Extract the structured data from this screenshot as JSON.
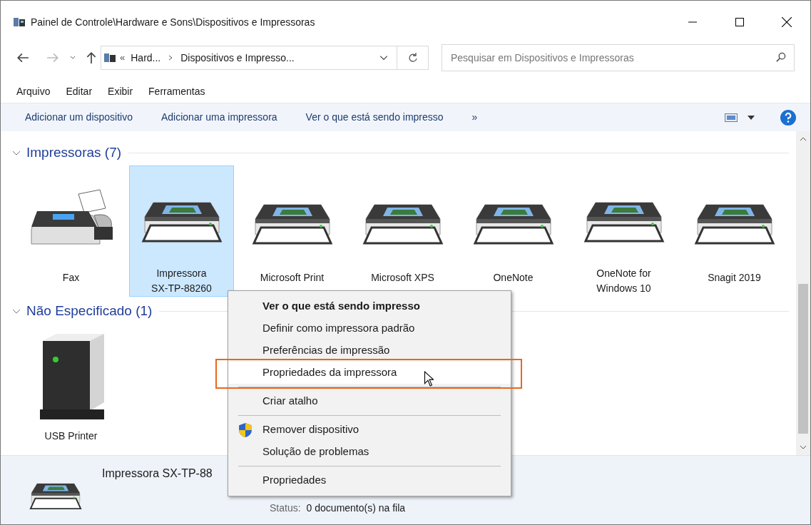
{
  "window": {
    "title": "Painel de Controle\\Hardware e Sons\\Dispositivos e Impressoras"
  },
  "address": {
    "overflow": "«",
    "crumbs": [
      "Hard...",
      "Dispositivos e Impresso..."
    ]
  },
  "search": {
    "placeholder": "Pesquisar em Dispositivos e Impressoras"
  },
  "menu_bar": [
    "Arquivo",
    "Editar",
    "Exibir",
    "Ferramentas"
  ],
  "command_bar": [
    "Adicionar um dispositivo",
    "Adicionar uma impressora",
    "Ver o que está sendo impresso",
    "»"
  ],
  "groups": [
    {
      "title": "Impressoras (7)",
      "expanded": true,
      "items": [
        {
          "kind": "fax",
          "lines": [
            "Fax"
          ],
          "selected": false
        },
        {
          "kind": "printer",
          "lines": [
            "Impressora",
            "SX-TP-88260"
          ],
          "selected": true
        },
        {
          "kind": "printer",
          "lines": [
            "Microsoft Print"
          ],
          "selected": false
        },
        {
          "kind": "printer",
          "lines": [
            "Microsoft XPS"
          ],
          "selected": false
        },
        {
          "kind": "printer",
          "lines": [
            "OneNote"
          ],
          "selected": false
        },
        {
          "kind": "printer",
          "lines": [
            "OneNote for",
            "Windows 10"
          ],
          "selected": false
        },
        {
          "kind": "printer",
          "lines": [
            "Snagit 2019"
          ],
          "selected": false
        }
      ]
    },
    {
      "title": "Não Especificado (1)",
      "expanded": true,
      "items": [
        {
          "kind": "device",
          "lines": [
            "USB Printer"
          ],
          "selected": false
        }
      ]
    }
  ],
  "context_menu": [
    {
      "kind": "item",
      "label": "Ver o que está sendo impresso",
      "bold": true,
      "hovered": false,
      "shield": false
    },
    {
      "kind": "item",
      "label": "Definir como impressora padrão",
      "bold": false,
      "hovered": false,
      "shield": false
    },
    {
      "kind": "item",
      "label": "Preferências de impressão",
      "bold": false,
      "hovered": false,
      "shield": false
    },
    {
      "kind": "item",
      "label": "Propriedades da impressora",
      "bold": false,
      "hovered": true,
      "shield": false
    },
    {
      "kind": "separator"
    },
    {
      "kind": "item",
      "label": "Criar atalho",
      "bold": false,
      "hovered": false,
      "shield": false
    },
    {
      "kind": "separator"
    },
    {
      "kind": "item",
      "label": "Remover dispositivo",
      "bold": false,
      "hovered": false,
      "shield": true
    },
    {
      "kind": "item",
      "label": "Solução de problemas",
      "bold": false,
      "hovered": false,
      "shield": false
    },
    {
      "kind": "separator"
    },
    {
      "kind": "item",
      "label": "Propriedades",
      "bold": false,
      "hovered": false,
      "shield": false
    }
  ],
  "details": {
    "title": "Impressora SX-TP-88",
    "status_label": "Status:",
    "status_value": "0 documento(s) na fila"
  }
}
